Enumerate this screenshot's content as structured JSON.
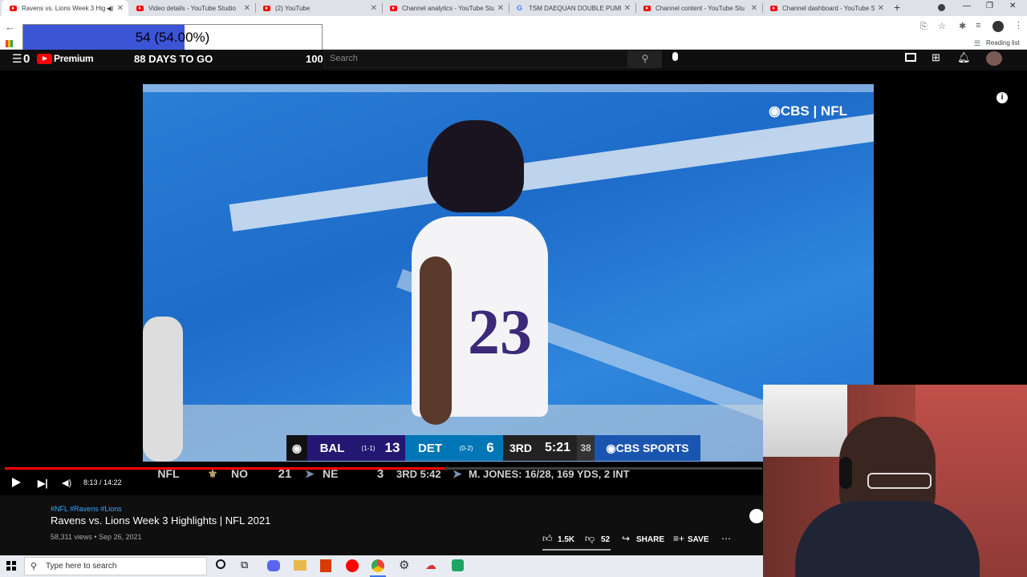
{
  "browser": {
    "tabs": [
      {
        "title": "Ravens vs. Lions Week 3 Hig",
        "icon": "youtube-favicon",
        "active": true
      },
      {
        "title": "Video details - YouTube Studio",
        "icon": "youtube-favicon",
        "active": false
      },
      {
        "title": "(2) YouTube",
        "icon": "youtube-favicon",
        "active": false
      },
      {
        "title": "Channel analytics - YouTube Stu",
        "icon": "youtube-favicon",
        "active": false
      },
      {
        "title": "TSM DAEQUAN DOUBLE PUMP",
        "icon": "google-favicon",
        "active": false
      },
      {
        "title": "Channel content - YouTube Stu",
        "icon": "youtube-favicon",
        "active": false
      },
      {
        "title": "Channel dashboard - YouTube S",
        "icon": "youtube-favicon",
        "active": false
      }
    ],
    "new_tab_label": "+",
    "reading_list_label": "Reading list"
  },
  "progress_overlay": {
    "text": "54 (54.00%)",
    "fraction": 0.54,
    "fill_color": "#3c55d6"
  },
  "youtube": {
    "notification_count": "0",
    "logo_text": "Premium",
    "countdown": "88 DAYS TO GO",
    "counter": "100",
    "search_placeholder": "Search"
  },
  "video": {
    "watermark": "◉CBS | NFL",
    "scorebug": {
      "away_team": "BAL",
      "away_record": "(1-1)",
      "away_score": "13",
      "home_team": "DET",
      "home_record": "(0-2)",
      "home_score": "6",
      "quarter": "3RD",
      "clock": "5:21",
      "play_clock": "38",
      "network": "◉CBS SPORTS"
    },
    "ticker": {
      "league": "NFL",
      "team1": "NO",
      "score1": "21",
      "team2": "NE",
      "score2": "3",
      "game_status": "3RD 5:42",
      "stat_line": "M. JONES: 16/28, 169 YDS, 2 INT"
    },
    "progress_fraction": 0.5803,
    "time_display": "8:13 / 14:22"
  },
  "video_info": {
    "hashtags": "#NFL #Ravens #Lions",
    "title": "Ravens vs. Lions Week 3 Highlights | NFL 2021",
    "meta": "58,311 views • Sep 26, 2021",
    "likes": "1.5K",
    "dislikes": "52",
    "share_label": "SHARE",
    "save_label": "SAVE"
  },
  "taskbar": {
    "search_placeholder": "Type here to search"
  },
  "colors": {
    "youtube_red": "#ff0000",
    "progress_red": "#ff0000",
    "ravens_purple": "#241773",
    "lions_blue": "#0076b6",
    "cbs_blue": "#1a56b0"
  }
}
